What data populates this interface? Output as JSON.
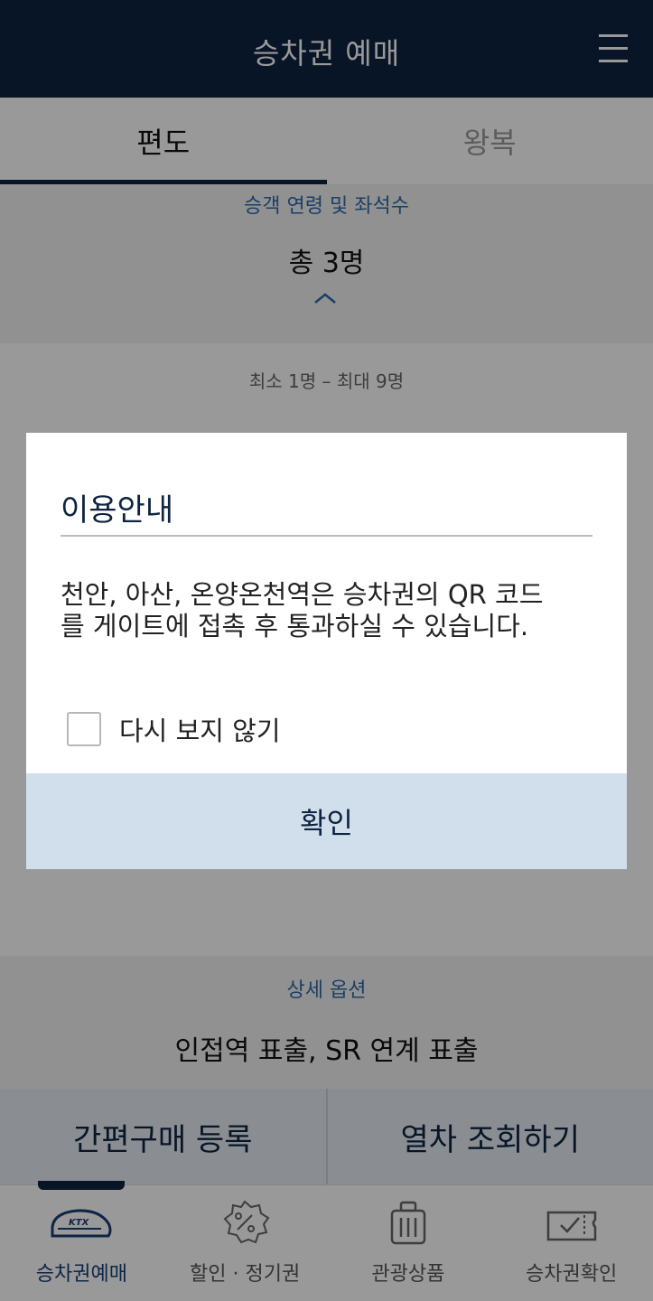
{
  "header": {
    "title": "승차권 예매"
  },
  "tabs": [
    {
      "label": "편도"
    },
    {
      "label": "왕복"
    }
  ],
  "passenger": {
    "section_label": "승객 연령 및 좌석수",
    "total": "총 3명",
    "min_max": "최소 1명 – 최대 9명"
  },
  "detail": {
    "section_label": "상세 옵션",
    "value": "인접역 표출, SR 연계 표출"
  },
  "actions": {
    "quick_purchase": "간편구매 등록",
    "search_trains": "열차 조회하기"
  },
  "nav": [
    {
      "label": "승차권예매",
      "icon": "ktx-train-icon"
    },
    {
      "label": "할인 · 정기권",
      "icon": "discount-badge-icon"
    },
    {
      "label": "관광상품",
      "icon": "luggage-icon"
    },
    {
      "label": "승차권확인",
      "icon": "ticket-check-icon"
    }
  ],
  "modal": {
    "title": "이용안내",
    "message": "천안, 아산, 온양온천역은 승차권의 QR 코드를 게이트에 접촉 후 통과하실 수 있습니다.",
    "dont_show_label": "다시 보지 않기",
    "confirm_label": "확인"
  },
  "colors": {
    "navy": "#0e2340",
    "accent_blue": "#2e6aa8",
    "confirm_bg": "#d1dfec"
  }
}
